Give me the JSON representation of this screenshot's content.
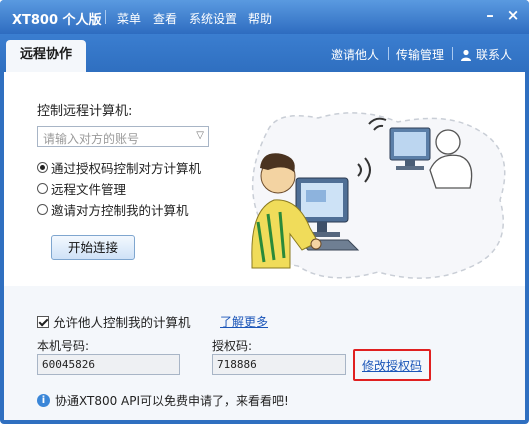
{
  "titlebar": {
    "app_title": "XT800 个人版",
    "menus": [
      "菜单",
      "查看",
      "系统设置",
      "帮助"
    ],
    "minimize": "–",
    "close": "×"
  },
  "tabs": {
    "active": "远程协作",
    "invite": "邀请他人",
    "transfer": "传输管理",
    "contacts": "联系人"
  },
  "remote": {
    "title": "控制远程计算机:",
    "account_placeholder": "请输入对方的账号",
    "options": [
      {
        "label": "通过授权码控制对方计算机",
        "checked": true
      },
      {
        "label": "远程文件管理",
        "checked": false
      },
      {
        "label": "邀请对方控制我的计算机",
        "checked": false
      }
    ],
    "start_button": "开始连接"
  },
  "local": {
    "allow_label": "允许他人控制我的计算机",
    "allow_checked": true,
    "learn_more": "了解更多",
    "machine_id_label": "本机号码:",
    "machine_id": "60045826",
    "auth_code_label": "授权码:",
    "auth_code": "718886",
    "change_code": "修改授权码"
  },
  "promo": {
    "text": "协通XT800 API可以免费申请了，来看看吧!"
  },
  "colors": {
    "titlebar": "#2e6cc0",
    "link": "#1a55b8",
    "highlight_box": "#e02020"
  }
}
